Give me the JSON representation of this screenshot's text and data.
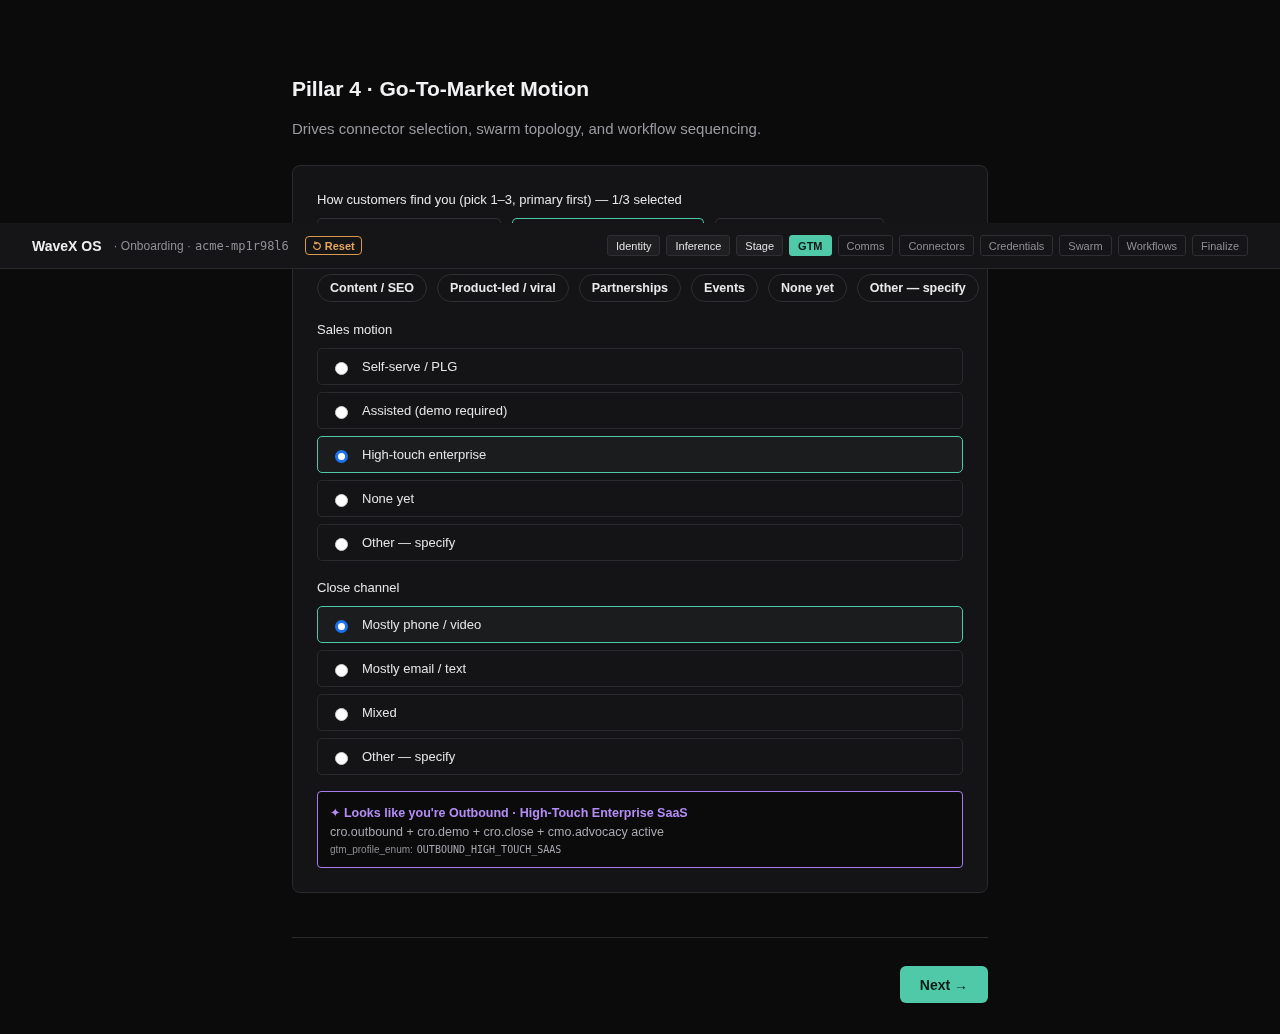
{
  "page": {
    "title": "Pillar 4 · Go-To-Market Motion",
    "subtitle": "Drives connector selection, swarm topology, and workflow sequencing."
  },
  "top_bar": {
    "brand": "WaveX OS",
    "context": "· Onboarding ·",
    "workspace_id": "acme-mp1r98l6",
    "reset_button": "Reset",
    "steps": [
      {
        "label": "Identity",
        "done": true,
        "selected": false
      },
      {
        "label": "Inference",
        "done": true,
        "selected": false
      },
      {
        "label": "Stage",
        "done": true,
        "selected": false
      },
      {
        "label": "GTM",
        "done": false,
        "selected": true
      },
      {
        "label": "Comms",
        "done": false,
        "selected": false
      },
      {
        "label": "Connectors",
        "done": false,
        "selected": false
      },
      {
        "label": "Credentials",
        "done": false,
        "selected": false
      },
      {
        "label": "Swarm",
        "done": false,
        "selected": false
      },
      {
        "label": "Workflows",
        "done": false,
        "selected": false
      },
      {
        "label": "Finalize",
        "done": false,
        "selected": false
      }
    ]
  },
  "acquisition": {
    "question": "How customers find you (pick 1–3, primary first) — 1/3 selected",
    "hidden_chips": [
      {
        "selected": false
      },
      {
        "selected": true
      },
      {
        "selected": false
      }
    ],
    "chips": [
      {
        "label": "Content / SEO",
        "selected": false
      },
      {
        "label": "Product-led / viral",
        "selected": false
      },
      {
        "label": "Partnerships",
        "selected": false
      },
      {
        "label": "Events",
        "selected": false
      },
      {
        "label": "None yet",
        "selected": false
      },
      {
        "label": "Other — specify",
        "selected": false
      }
    ]
  },
  "sales_motion": {
    "label": "Sales motion",
    "options": [
      {
        "label": "Self-serve / PLG",
        "selected": false
      },
      {
        "label": "Assisted (demo required)",
        "selected": false
      },
      {
        "label": "High-touch enterprise",
        "selected": true
      },
      {
        "label": "None yet",
        "selected": false
      },
      {
        "label": "Other — specify",
        "selected": false
      }
    ]
  },
  "close_channel": {
    "label": "Close channel",
    "options": [
      {
        "label": "Mostly phone / video",
        "selected": true
      },
      {
        "label": "Mostly email / text",
        "selected": false
      },
      {
        "label": "Mixed",
        "selected": false
      },
      {
        "label": "Other — specify",
        "selected": false
      }
    ]
  },
  "profile": {
    "headline": "✦ Looks like you're Outbound · High-Touch Enterprise SaaS",
    "agents": "cro.outbound + cro.demo + cro.close + cmo.advocacy active",
    "enum_label": "gtm_profile_enum:",
    "enum_value": "OUTBOUND_HIGH_TOUCH_SAAS"
  },
  "next_button": "Next →"
}
